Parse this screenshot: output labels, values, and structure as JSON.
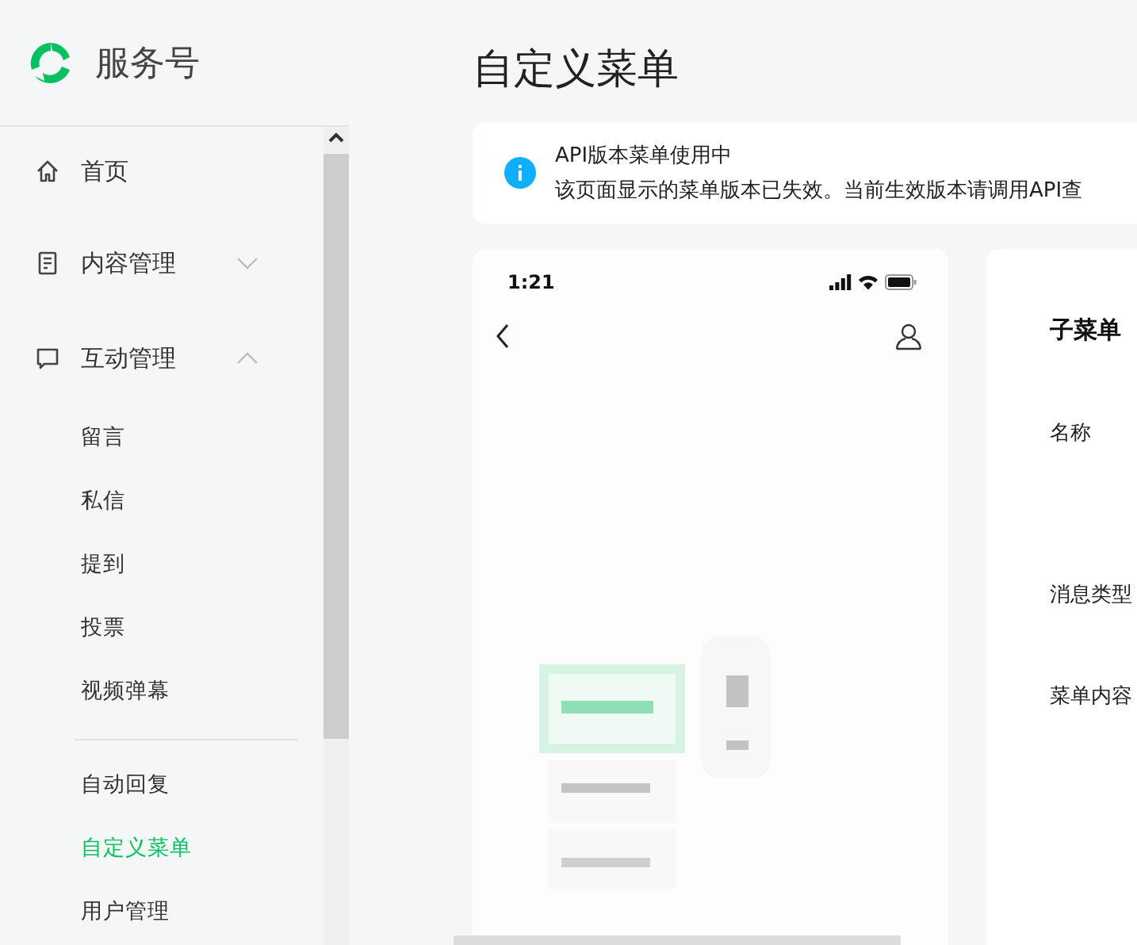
{
  "brand": {
    "name": "服务号"
  },
  "nav": [
    {
      "label": "首页",
      "selected": false
    },
    {
      "label": "内容管理",
      "selected": false,
      "expanded": false
    },
    {
      "label": "互动管理",
      "selected": false,
      "expanded": true,
      "children": [
        {
          "label": "留言",
          "selected": false
        },
        {
          "label": "私信",
          "selected": false
        },
        {
          "label": "提到",
          "selected": false
        },
        {
          "label": "投票",
          "selected": false
        },
        {
          "label": "视频弹幕",
          "selected": false
        }
      ]
    }
  ],
  "nav_secondary": [
    {
      "label": "自动回复",
      "selected": false
    },
    {
      "label": "自定义菜单",
      "selected": true
    },
    {
      "label": "用户管理",
      "selected": false
    }
  ],
  "page_title": "自定义菜单",
  "notice": {
    "title": "API版本菜单使用中",
    "text": "该页面显示的菜单版本已失效。当前生效版本请调用API查"
  },
  "phone": {
    "time": "1:21"
  },
  "panel": {
    "title": "子菜单",
    "fields": [
      "名称",
      "消息类型",
      "菜单内容"
    ]
  }
}
